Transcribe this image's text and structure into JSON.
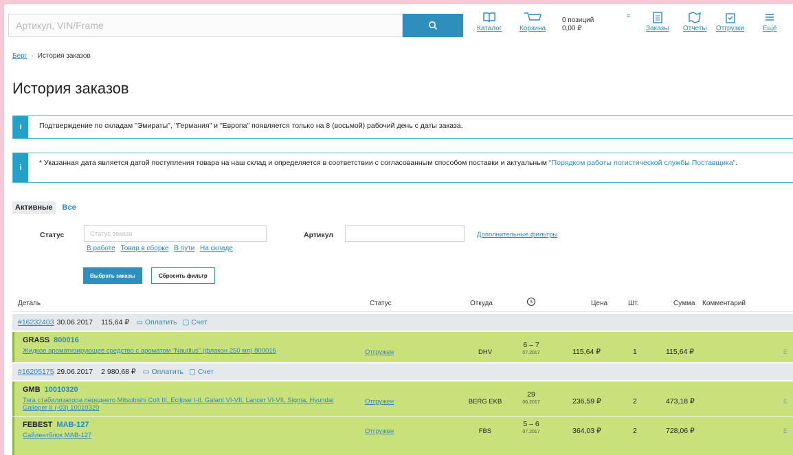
{
  "search": {
    "placeholder": "Артикул, VIN/Frame"
  },
  "nav": {
    "catalog": "Каталог",
    "cart": "Корзина",
    "cart_count": "0 позиций",
    "cart_sum": "0,00 ₽",
    "orders": "Заказы",
    "reports": "Отчеты",
    "shipments": "Отгрузки",
    "more": "Ещё"
  },
  "breadcrumb": {
    "root": "Берг",
    "current": "История заказов"
  },
  "page_title": "История заказов",
  "alerts": {
    "first": "Подтверждение по складам \"Эмираты\", \"Германия\" и \"Европа\" появляется только на 8 (восьмой) рабочий день с даты заказа.",
    "second_text": "* Указанная дата является датой поступления товара на наш склад и определяется в соответствии с согласованным способом поставки и актуальным ",
    "second_link": "\"Порядком работы логистической службы Поставщика\"",
    "second_tail": "."
  },
  "tabs": {
    "active": "Активные",
    "all": "Все"
  },
  "filters": {
    "status_label": "Статус",
    "status_placeholder": "Статус заказа",
    "article_label": "Артикул",
    "more_filters": "Дополнительные фильтры",
    "quick": [
      "В работе",
      "Товар в сборке",
      "В пути",
      "На складе"
    ],
    "apply": "Выбрать заказы",
    "reset": "Сбросить фильтр"
  },
  "table": {
    "headers": {
      "detail": "Деталь",
      "status": "Статус",
      "from": "Откуда",
      "price": "Цена",
      "qty": "Шт.",
      "total": "Сумма",
      "comment": "Комментарий"
    },
    "pay_label": "Оплатить",
    "invoice_label": "Счет",
    "groups": [
      {
        "order": "#16232403",
        "date": "30.06.2017",
        "sum": "115,64 ₽"
      },
      {
        "order": "#16205175",
        "date": "29.06.2017",
        "sum": "2 980,68 ₽"
      }
    ],
    "rows": [
      {
        "brand": "GRASS",
        "article": "800016",
        "desc": "Жидкое ароматизирующее средство с ароматом \"Nautilus\" (флакон 250 мл) 800016",
        "status": "Отгружен",
        "from": "DHV",
        "eta": "6 – 7",
        "eta_sub": "07.2017",
        "price": "115,64 ₽",
        "qty": "1",
        "total": "115,64 ₽"
      },
      {
        "brand": "GMB",
        "article": "10010320",
        "desc": "Тяга стабилизатора переднего Mitsubishi Colt III, Eclipse I-II, Galant VI-VII, Lancer VI-VII, Sigma, Hyundai Galloper II (-03) 10010320",
        "status": "Отгружен",
        "from": "BERG EKB",
        "eta": "29",
        "eta_sub": "06.2017",
        "price": "236,59 ₽",
        "qty": "2",
        "total": "473,18 ₽"
      },
      {
        "brand": "FEBEST",
        "article": "MAB-127",
        "desc": "Сайлентблок MAB-127",
        "status": "Отгружен",
        "from": "FBS",
        "eta": "5 – 6",
        "eta_sub": "07.2017",
        "price": "364,03 ₽",
        "qty": "2",
        "total": "728,06 ₽"
      }
    ]
  }
}
